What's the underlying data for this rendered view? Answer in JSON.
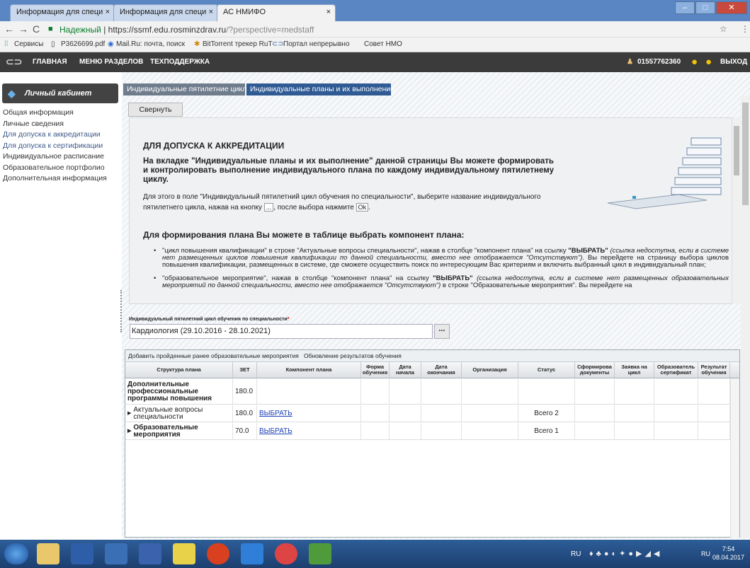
{
  "browser": {
    "tabs": [
      "Информация для специ",
      "Информация для специ",
      "АС НМИФО"
    ],
    "address": {
      "secure_label": "Надежный",
      "url_prefix": "https://",
      "url_main": "ssmf.edu.rosminzdrav.ru",
      "url_rest": "/?perspective=medstaff"
    },
    "bookmarks": [
      "Сервисы",
      "P3626699.pdf",
      "Mail.Ru: почта, поиск",
      "BitTorrent трекер RuT",
      "Портал непрерывно",
      "Совет НМО"
    ]
  },
  "site": {
    "menu": [
      "ГЛАВНАЯ",
      "МЕНЮ РАЗДЕЛОВ",
      "ТЕХПОДДЕРЖКА"
    ],
    "user_id": "01557762360",
    "logout": "ВЫХОД"
  },
  "cabinet": {
    "title": "Личный кабинет",
    "menu": [
      "Общая информация",
      "Личные сведения",
      "Для допуска к аккредитации",
      "Для допуска к сертификации",
      "Индивидуальное расписание",
      "Образовательное портфолио",
      "Дополнительная информация"
    ]
  },
  "page_tabs": [
    "Индивидуальные пятилетние циклы",
    "Индивидуальные планы и их выполнение"
  ],
  "collapse_label": "Свернуть",
  "info": {
    "title": "ДЛЯ ДОПУСКА К АККРЕДИТАЦИИ",
    "intro": "На вкладке \"Индивидуальные планы и их выполнение\" данной страницы Вы можете формировать и контролировать выполнение индивидуального плана по каждому индивидуальному пятилетнему циклу.",
    "step_a": "Для этого в поле \"Индивидуальный пятилетний цикл обучения по специальности\", выберите название индивидуального пятилетнего цикла, нажав на кнопку",
    "step_b": ", после выбора нажмите",
    "dots_btn": "...",
    "ok_btn": "Ok",
    "heading2": "Для формирования плана Вы можете в таблице выбрать компонент плана:",
    "bullet1_a": "\"цикл повышения квалификации\" в строке \"Актуальные вопросы специальности\", нажав в столбце \"компонент плана\" на ссылку ",
    "bullet1_b": "\"ВЫБРАТЬ\"",
    "bullet1_c": " (ссылка недоступна, если в системе нет размещенных циклов повышения квалификации по данной специальности, вместо нее отображается \"Отсутствуют\")",
    "bullet1_d": ". Вы перейдете на страницу выбора циклов повышения квалификации, размещенных в системе, где сможете осуществить поиск по интересующим Вас критериям и включить выбранный цикл в индивидуальный план;",
    "bullet2_a": "\"образовательное мероприятие\", нажав в столбце \"компонент плана\" на ссылку ",
    "bullet2_b": "\"ВЫБРАТЬ\"",
    "bullet2_c": " (ссылка недоступна, если в системе нет размещенных образовательных мероприятий по данной специальности, вместо нее отображается \"Отсутствуют\")",
    "bullet2_d": " в строке \"Образовательные мероприятия\". Вы перейдете на"
  },
  "selector": {
    "label": "Индивидуальный пятилетний цикл обучения по специальности",
    "required": "*",
    "value": "Кардиология (29.10.2016 - 28.10.2021)",
    "btn": "..."
  },
  "grid": {
    "toolbar": [
      "Добавить пройденные ранее образовательные мероприятия",
      "Обновление результатов обучения"
    ],
    "columns": [
      "Структура плана",
      "ЗЕТ",
      "Компонент плана",
      "Форма обучения",
      "Дата начала",
      "Дата окончания",
      "Организация",
      "Статус",
      "Сформирова документы",
      "Заявка на цикл",
      "Образователь сертификат",
      "Результат обучения"
    ],
    "rows": [
      {
        "structure": "Дополнительные профессиональные программы повышения",
        "zet": "180.0",
        "component": "",
        "status": ""
      },
      {
        "structure": "Актуальные вопросы специальности",
        "zet": "180.0",
        "component": "ВЫБРАТЬ",
        "status": "Всего 2"
      },
      {
        "structure": "Образовательные мероприятия",
        "zet": "70.0",
        "component": "ВЫБРАТЬ",
        "status": "Всего 1"
      }
    ]
  },
  "taskbar": {
    "lang": "RU",
    "lang2": "RU",
    "time": "7:54",
    "date": "08.04.2017"
  }
}
